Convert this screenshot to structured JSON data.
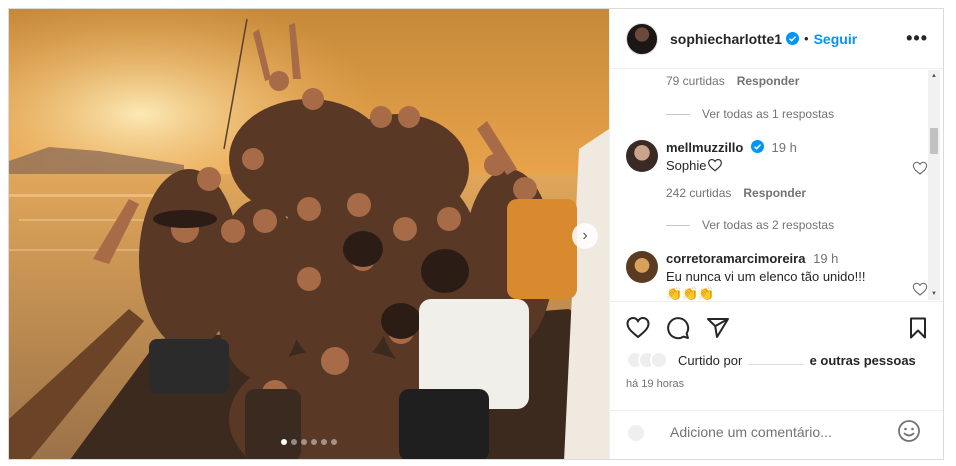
{
  "post": {
    "username": "sophiecharlotte1",
    "separator": "•",
    "follow_label": "Seguir",
    "more_label": "•••",
    "next_label": "›",
    "carousel": {
      "count": 6,
      "active_index": 0
    }
  },
  "comments": {
    "first_meta": {
      "likes": "79 curtidas",
      "reply": "Responder"
    },
    "first_view_all": "Ver todas as 1 respostas",
    "items": [
      {
        "username": "mellmuzzillo",
        "verified": true,
        "time": "19 h",
        "text": "Sophie",
        "likes": "242 curtidas",
        "reply": "Responder",
        "view_all": "Ver todas as 2 respostas"
      },
      {
        "username": "corretoramarcimoreira",
        "verified": false,
        "time": "19 h",
        "text": "Eu nunca vi um elenco tão unido!!!",
        "emojis": "👏👏👏"
      }
    ]
  },
  "actions": {
    "liked_by_prefix": "Curtido por",
    "liked_by_suffix": "e outras pessoas",
    "time_ago": "há 19 horas"
  },
  "add_comment": {
    "placeholder": "Adicione um comentário..."
  },
  "colors": {
    "accent": "#0095f6",
    "verified": "#0095f6",
    "text": "#262626",
    "muted": "#737373"
  }
}
